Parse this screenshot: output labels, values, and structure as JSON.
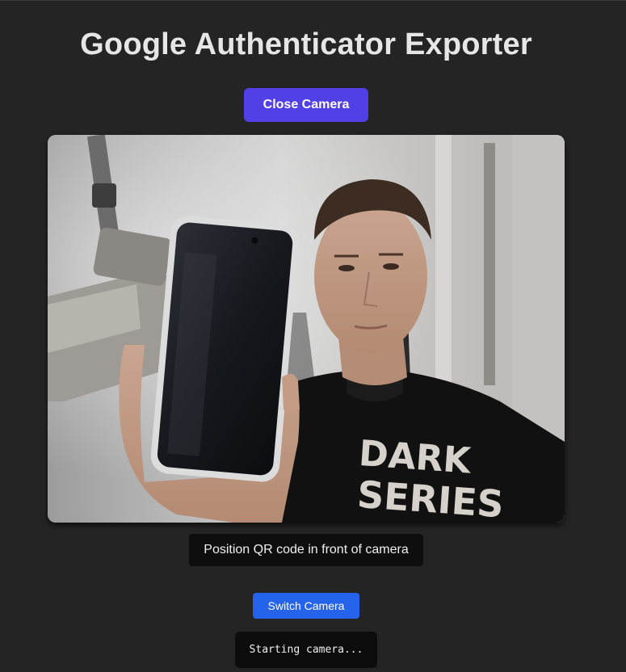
{
  "header": {
    "title": "Google Authenticator Exporter"
  },
  "controls": {
    "close_camera_label": "Close Camera",
    "switch_camera_label": "Switch Camera"
  },
  "camera": {
    "hint": "Position QR code in front of camera",
    "shirt_text_line1": "DARK",
    "shirt_text_line2": "SERIES"
  },
  "log": {
    "message": "Starting camera..."
  },
  "colors": {
    "background": "#242424",
    "primary_button": "#5140e5",
    "secondary_button": "#2563eb",
    "label_background": "#0e0e0e"
  }
}
